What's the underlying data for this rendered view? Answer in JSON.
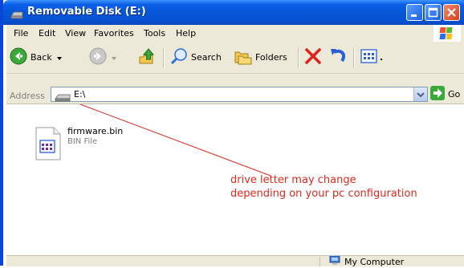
{
  "window": {
    "title": "Removable Disk (E:)"
  },
  "menu": {
    "items": [
      "File",
      "Edit",
      "View",
      "Favorites",
      "Tools",
      "Help"
    ]
  },
  "toolbar": {
    "back_label": "Back",
    "search_label": "Search",
    "folders_label": "Folders"
  },
  "address": {
    "label": "Address",
    "value": "E:\\",
    "go_label": "Go"
  },
  "files": [
    {
      "name": "firmware.bin",
      "type": "BIN File"
    }
  ],
  "annotation": {
    "line1": "drive letter may change",
    "line2": "depending on your pc configuration",
    "color": "#e0281e"
  },
  "statusbar": {
    "location": "My Computer"
  },
  "colors": {
    "titlebar": "#0756d8",
    "chrome": "#ece9d8"
  }
}
